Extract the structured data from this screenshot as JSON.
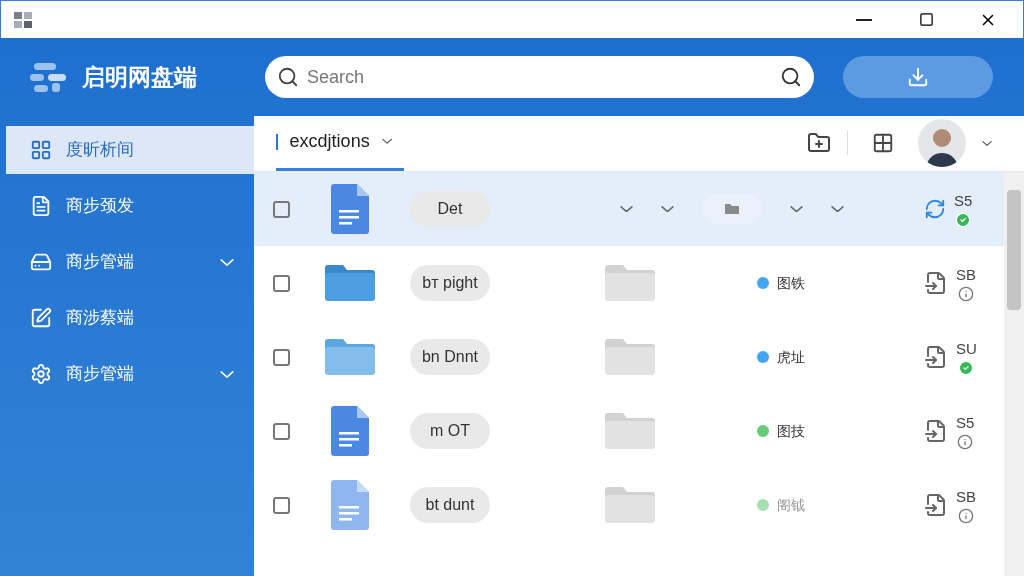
{
  "app": {
    "name": "启明网盘端"
  },
  "search": {
    "placeholder": "Search"
  },
  "sidebar": {
    "items": [
      {
        "label": "度昕析间",
        "selected": true,
        "expandable": false
      },
      {
        "label": "商步颈发",
        "selected": false,
        "expandable": false
      },
      {
        "label": "商步管端",
        "selected": false,
        "expandable": true
      },
      {
        "label": "商涉蔡端",
        "selected": false,
        "expandable": false
      },
      {
        "label": "商步管端",
        "selected": false,
        "expandable": true
      }
    ]
  },
  "tab": {
    "label": "excdjtions"
  },
  "rows": [
    {
      "kind": "doc",
      "faded": false,
      "selected": true,
      "tag": "Det",
      "status": null,
      "size": "S5",
      "synced": true
    },
    {
      "kind": "folder",
      "faded": false,
      "selected": false,
      "tag": "bт pight",
      "status": {
        "text": "图铁",
        "color": "#42a5f5"
      },
      "size": "SB",
      "synced": false
    },
    {
      "kind": "folder",
      "faded": true,
      "selected": false,
      "tag": "bn Dnnt",
      "status": {
        "text": "虎址",
        "color": "#42a5f5"
      },
      "size": "SU",
      "synced": true
    },
    {
      "kind": "doc",
      "faded": false,
      "selected": false,
      "tag": "m OT",
      "status": {
        "text": "图技",
        "color": "#66cc77"
      },
      "size": "S5",
      "synced": false
    },
    {
      "kind": "doc",
      "faded": true,
      "selected": false,
      "tag": "bt dunt",
      "status": {
        "text": "阁钺",
        "color": "#a6dfb0"
      },
      "size": "SB",
      "synced": false
    }
  ]
}
